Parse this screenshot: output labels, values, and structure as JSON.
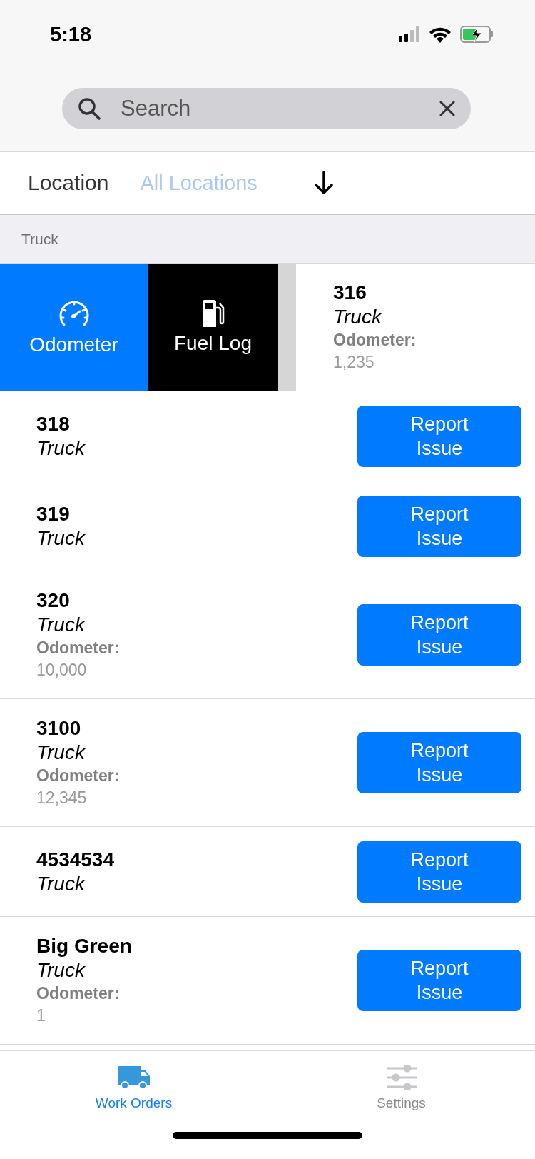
{
  "status_bar": {
    "time": "5:18"
  },
  "search": {
    "placeholder": "Search"
  },
  "location_filter": {
    "label": "Location",
    "placeholder": "All Locations"
  },
  "section": {
    "title": "Truck"
  },
  "swipe_actions": [
    {
      "label": "Odometer",
      "kind": "odometer"
    },
    {
      "label": "Fuel Log",
      "kind": "fuel"
    }
  ],
  "vehicles": [
    {
      "name": "316",
      "type": "Truck",
      "odometer_label": "Odometer:",
      "odometer": "1,235",
      "swiped": true
    },
    {
      "name": "318",
      "type": "Truck",
      "swiped": false,
      "button": "Report Issue"
    },
    {
      "name": "319",
      "type": "Truck",
      "swiped": false,
      "button": "Report Issue"
    },
    {
      "name": "320",
      "type": "Truck",
      "odometer_label": "Odometer:",
      "odometer": "10,000",
      "swiped": false,
      "button": "Report Issue"
    },
    {
      "name": "3100",
      "type": "Truck",
      "odometer_label": "Odometer:",
      "odometer": "12,345",
      "swiped": false,
      "button": "Report Issue"
    },
    {
      "name": "4534534",
      "type": "Truck",
      "swiped": false,
      "button": "Report Issue"
    },
    {
      "name": "Big Green",
      "type": "Truck",
      "odometer_label": "Odometer:",
      "odometer": "1",
      "swiped": false,
      "button": "Report Issue"
    }
  ],
  "tabs": [
    {
      "label": "Work Orders",
      "kind": "truck",
      "selected": true
    },
    {
      "label": "Settings",
      "kind": "sliders",
      "selected": false
    }
  ]
}
